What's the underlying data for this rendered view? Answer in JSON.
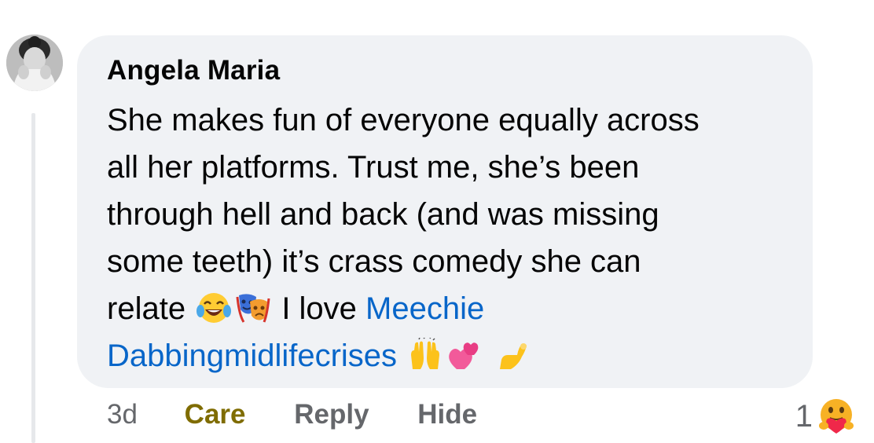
{
  "comment": {
    "author": "Angela Maria",
    "lines": {
      "l1": "She makes fun of everyone equally across",
      "l2": "all her platforms. Trust me, she’s been",
      "l3": "through hell and back (and was missing",
      "l4": "some teeth) it’s crass comedy she can",
      "l5_text": "relate",
      "l5_after": "I love",
      "mention_first": "Meechie",
      "mention_second": "Dabbingmidlifecrises"
    },
    "emojis": [
      "laughing-tears-icon",
      "performing-arts-icon",
      "raising-hands-icon",
      "revolving-hearts-icon",
      "pinching-hand-icon"
    ]
  },
  "actions": {
    "time": "3d",
    "care": "Care",
    "reply": "Reply",
    "hide": "Hide"
  },
  "reactions": {
    "count": "1",
    "icon": "care-emoji-icon"
  },
  "colors": {
    "bubble": "#f0f2f5",
    "text": "#050505",
    "mention": "#0866c9",
    "muted": "#65676b",
    "care": "#7f6c00"
  }
}
